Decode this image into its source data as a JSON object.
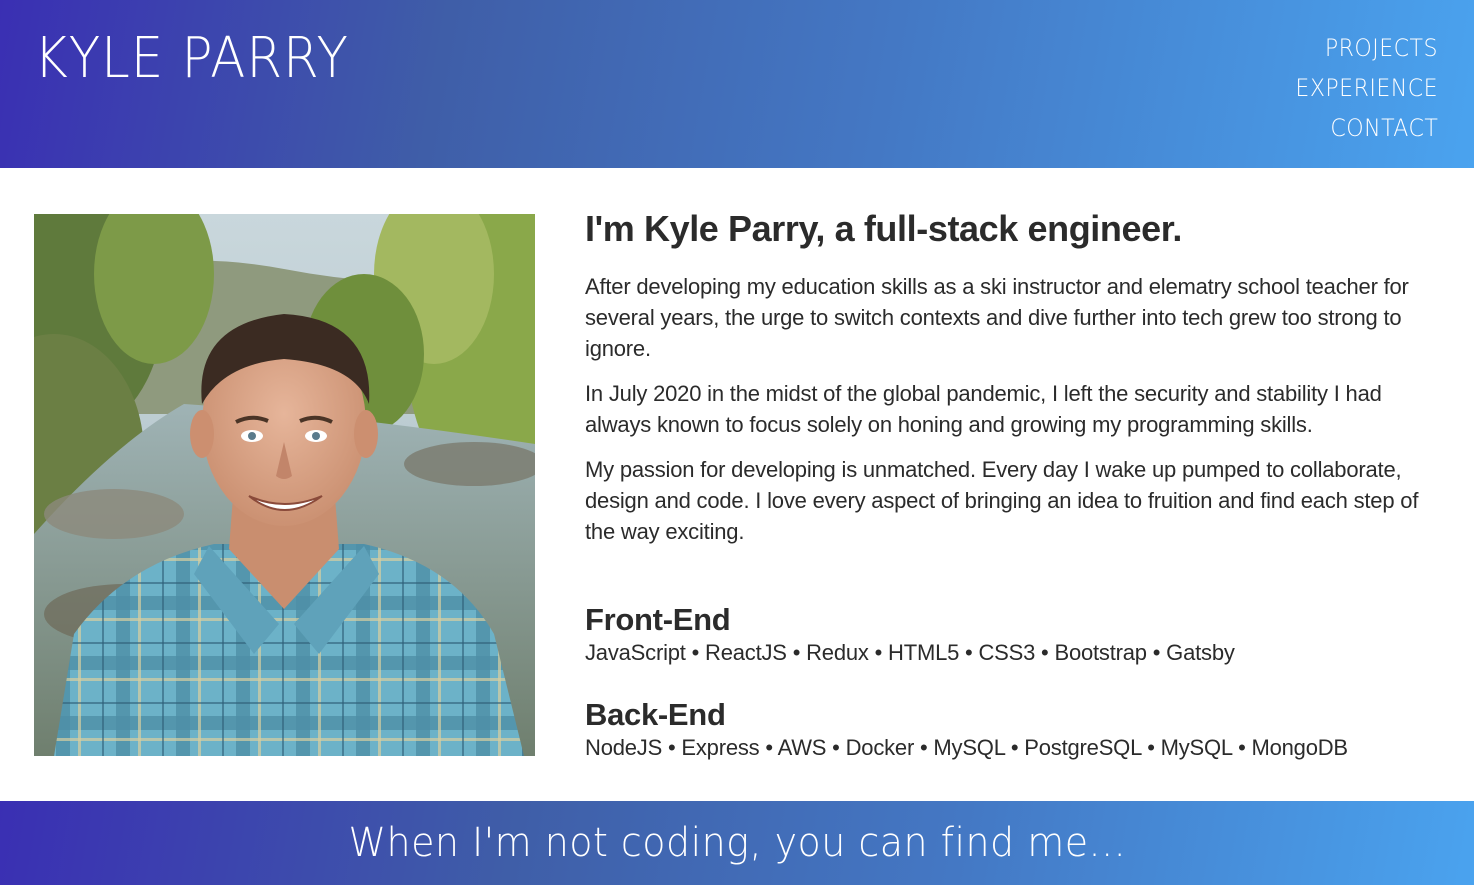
{
  "header": {
    "brand": "KYLE PARRY",
    "nav": [
      "PROJECTS",
      "EXPERIENCE",
      "CONTACT"
    ]
  },
  "about": {
    "headline": "I'm Kyle Parry, a full-stack engineer.",
    "paragraphs": [
      "After developing my education skills as a ski instructor and elematry school teacher for several years, the urge to switch contexts and dive further into tech grew too strong to ignore.",
      "In July 2020 in the midst of the global pandemic, I left the security and stability I had always known to focus solely on honing and growing my programming skills.",
      "My passion for developing is unmatched. Every day I wake up pumped to collaborate, design and code. I love every aspect of bringing an idea to fruition and find each step of the way exciting."
    ]
  },
  "skills": {
    "frontend": {
      "title": "Front-End",
      "list": "JavaScript • ReactJS • Redux • HTML5 • CSS3 • Bootstrap • Gatsby"
    },
    "backend": {
      "title": "Back-End",
      "list": "NodeJS • Express • AWS • Docker • MySQL • PostgreSQL • MySQL • MongoDB"
    }
  },
  "footer": {
    "text": "When I'm not coding, you can find me..."
  },
  "colors": {
    "gradient_start": "#3a2fb3",
    "gradient_end": "#4aa3ef",
    "text": "#2b2b2b"
  }
}
